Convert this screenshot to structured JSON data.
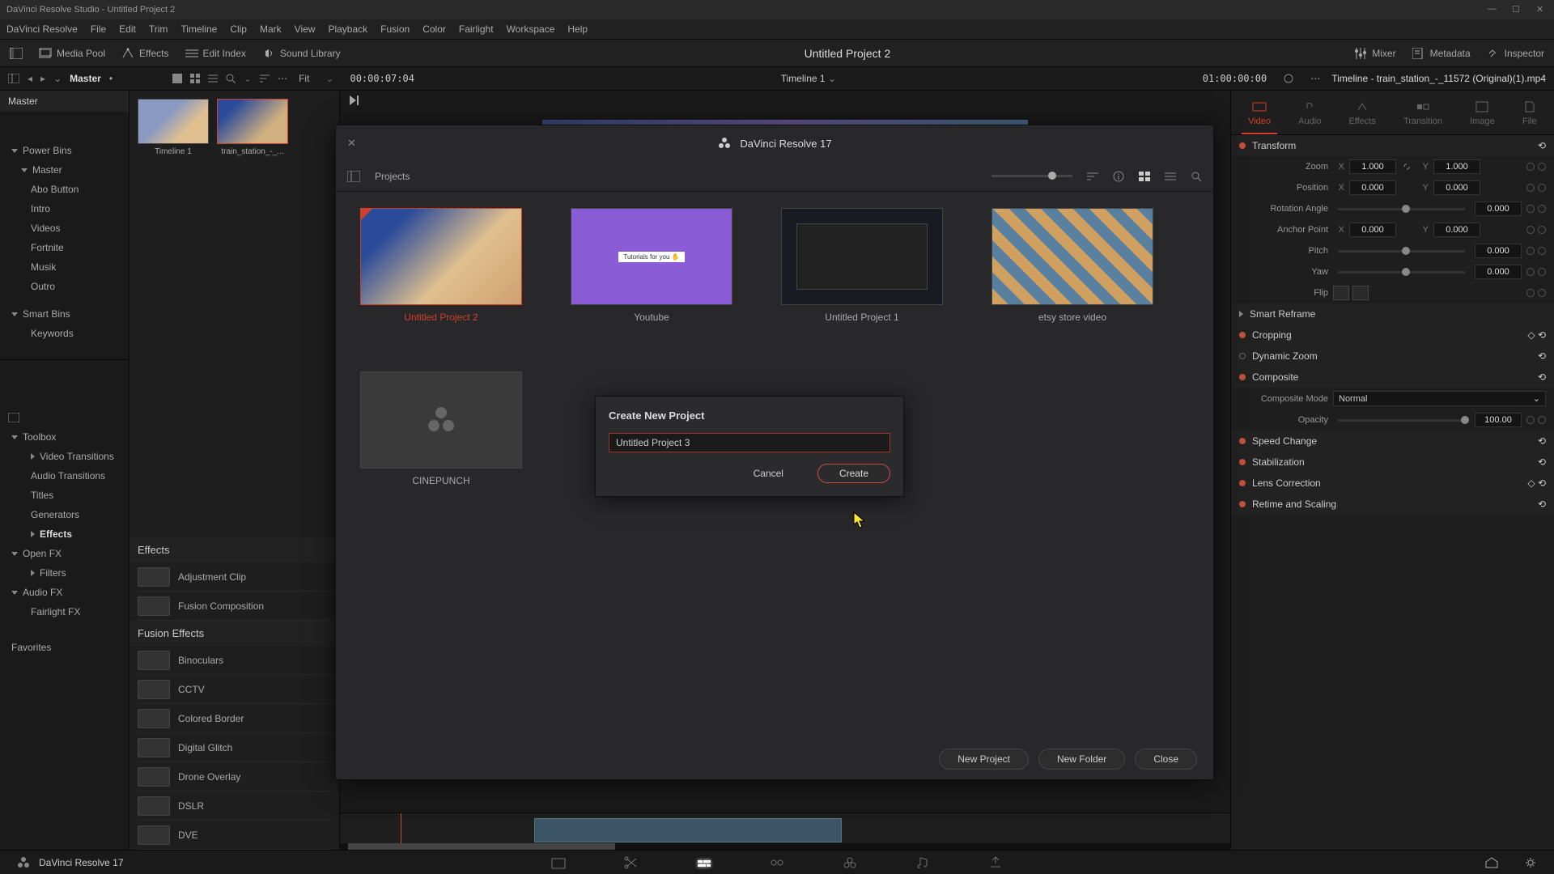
{
  "titlebar": "DaVinci Resolve Studio - Untitled Project 2",
  "menubar": [
    "DaVinci Resolve",
    "File",
    "Edit",
    "Trim",
    "Timeline",
    "Clip",
    "Mark",
    "View",
    "Playback",
    "Fusion",
    "Color",
    "Fairlight",
    "Workspace",
    "Help"
  ],
  "toolbar": {
    "media_pool": "Media Pool",
    "effects": "Effects",
    "edit_index": "Edit Index",
    "sound_library": "Sound Library",
    "project_title": "Untitled Project 2",
    "mixer": "Mixer",
    "metadata": "Metadata",
    "inspector": "Inspector"
  },
  "subtoolbar": {
    "master": "Master",
    "fit": "Fit",
    "tc_in": "00:00:07:04",
    "timeline_dropdown": "Timeline 1",
    "tc_out": "01:00:00:00",
    "clip_title": "Timeline - train_station_-_11572 (Original)(1).mp4"
  },
  "left_sidebar": {
    "master_head": "Master",
    "power_bins": "Power Bins",
    "master_item": "Master",
    "bins": [
      "Abo Button",
      "Intro",
      "Videos",
      "Fortnite",
      "Musik",
      "Outro"
    ],
    "smart_bins": "Smart Bins",
    "keywords": "Keywords",
    "toolbox": "Toolbox",
    "toolbox_items": [
      "Video Transitions",
      "Audio Transitions",
      "Titles",
      "Generators"
    ],
    "effects_item": "Effects",
    "open_fx": "Open FX",
    "filters": "Filters",
    "audio_fx": "Audio FX",
    "fairlight_fx": "Fairlight FX",
    "favorites": "Favorites"
  },
  "media_thumbs": [
    {
      "label": "Timeline 1"
    },
    {
      "label": "train_station_-_..."
    }
  ],
  "effects_panel": {
    "head": "Effects",
    "items": [
      "Adjustment Clip",
      "Fusion Composition"
    ],
    "fusion_head": "Fusion Effects",
    "fusion_items": [
      "Binoculars",
      "CCTV",
      "Colored Border",
      "Digital Glitch",
      "Drone Overlay",
      "DSLR",
      "DVE"
    ]
  },
  "inspector": {
    "tabs": [
      "Video",
      "Audio",
      "Effects",
      "Transition",
      "Image",
      "File"
    ],
    "transform": "Transform",
    "zoom": "Zoom",
    "zoom_x": "1.000",
    "zoom_y": "1.000",
    "position": "Position",
    "pos_x": "0.000",
    "pos_y": "0.000",
    "rotation": "Rotation Angle",
    "rot_v": "0.000",
    "anchor": "Anchor Point",
    "anc_x": "0.000",
    "anc_y": "0.000",
    "pitch": "Pitch",
    "pitch_v": "0.000",
    "yaw": "Yaw",
    "yaw_v": "0.000",
    "flip": "Flip",
    "smart_reframe": "Smart Reframe",
    "cropping": "Cropping",
    "dynamic_zoom": "Dynamic Zoom",
    "composite": "Composite",
    "composite_mode_label": "Composite Mode",
    "composite_mode": "Normal",
    "opacity": "Opacity",
    "opacity_v": "100.00",
    "speed_change": "Speed Change",
    "stabilization": "Stabilization",
    "lens_correction": "Lens Correction",
    "retime": "Retime and Scaling",
    "x": "X",
    "y": "Y"
  },
  "project_manager": {
    "title": "DaVinci Resolve 17",
    "breadcrumb": "Projects",
    "projects": [
      {
        "name": "Untitled Project 2"
      },
      {
        "name": "Youtube"
      },
      {
        "name": "Untitled Project 1"
      },
      {
        "name": "etsy store video"
      },
      {
        "name": "CINEPUNCH"
      }
    ],
    "new_project": "New Project",
    "new_folder": "New Folder",
    "close": "Close"
  },
  "create_dialog": {
    "title": "Create New Project",
    "value": "Untitled Project 3",
    "cancel": "Cancel",
    "create": "Create"
  },
  "pagebar": {
    "app": "DaVinci Resolve 17"
  }
}
